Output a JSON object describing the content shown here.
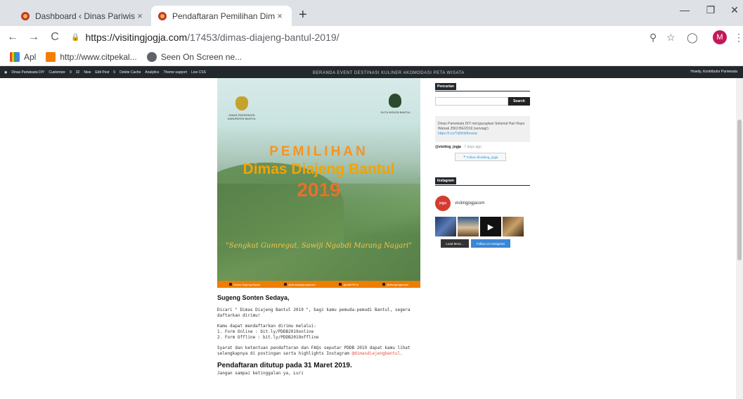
{
  "browser": {
    "tabs": [
      {
        "title": "Dashboard ‹ Dinas Pariwisata DIY",
        "close": "×"
      },
      {
        "title": "Pendaftaran Pemilihan Dimas Diajeng",
        "close": "×"
      }
    ],
    "new_tab": "+",
    "window_controls": {
      "minimize": "—",
      "restore": "❐",
      "close": "✕"
    },
    "nav": {
      "back": "←",
      "forward": "→",
      "reload": "C"
    },
    "url": {
      "domain": "https://visitingjogja.com",
      "path": "/17453/dimas-diajeng-bantul-2019/"
    },
    "avatar_letter": "M",
    "bookmarks": [
      {
        "label": "Apl",
        "icon": "apps-icon"
      },
      {
        "label": "http://www.citpekal...",
        "icon": "blogger-icon"
      },
      {
        "label": "Seen On Screen ne...",
        "icon": "globe-icon"
      }
    ]
  },
  "wp_admin_bar": {
    "items": [
      "Dinas Pariwisata DIY",
      "Customize",
      "9",
      "32",
      "New",
      "Edit Post",
      "0",
      "Delete Cache",
      "Analytics",
      "Theme support",
      "Live CSS"
    ],
    "site_nav": "BERANDA   EVENT   DESTINASI   KULINER   AKOMODASI   PETA WISATA",
    "howdy": "Howdy, Kontributor Pariwisata"
  },
  "poster": {
    "line1": "PEMILIHAN",
    "line2": "Dimas Diajeng Bantul",
    "line3": "2019",
    "tagline": "\"Sengkut Gumregut, Sawiji Ngabdi Marang Nagari\"",
    "logo_left": "DINAS PARIWISATA KABUPATEN BANTUL",
    "logo_right": "DUTA WISATA BANTUL",
    "footer": [
      "Dimas Diajeng Bantul",
      "@dimasdiajengbantul",
      "@ddbPBTlo",
      "@dimajengbantul"
    ]
  },
  "article": {
    "greeting": "Sugeng Sonten Sedaya,",
    "p1": "Dicari \" Dimas Diajeng Bantul 2019 \", bagi kamu pemuda-pemudi Bantul, segera daftarkan dirimu!",
    "p2_intro": "Kamu dapat mendaftarkan dirimu melalui:",
    "p2_line1": "1. Form Online : bit.ly/PDDB2019online",
    "p2_line2": "2. Form Offline : bit.ly/PDDB2019offline",
    "p3": "Syarat dan ketentuan pendaftaran dan FAQs seputar PDDB 2019 dapat kamu lihat selengkapnya di postingan serta highlights Instagram",
    "p3_link": "@dimasdiajengbantul",
    "p3_end": ".",
    "closing": "Pendaftaran ditutup pada 31 Maret 2019.",
    "closing_sub": "Jangan sampai ketinggalan ya, Luri"
  },
  "sidebar": {
    "search_title": "Pencarian",
    "search_button": "Search",
    "tweet_text": "Dinas Pariwisata DIY mengucapkan Selamat Hari Raya Waisak 2563 BE/2019  (serviagr)",
    "tweet_link": "https://t.co/TqWdxBexww",
    "tweet_handle": "@visiting_jogja",
    "tweet_time": "· 7 days ago",
    "follow_button": "Follow @visiting_jogja",
    "instagram_title": "Instagram",
    "ig_user": "visitingjogjacom",
    "load_more": "Load More...",
    "follow_ig": "Follow on Instagram"
  },
  "colors": {
    "accent": "#e74c3c",
    "poster_orange": "#ef7d00",
    "ig_blue": "#3b86d6",
    "wp_bar": "#23282d"
  }
}
